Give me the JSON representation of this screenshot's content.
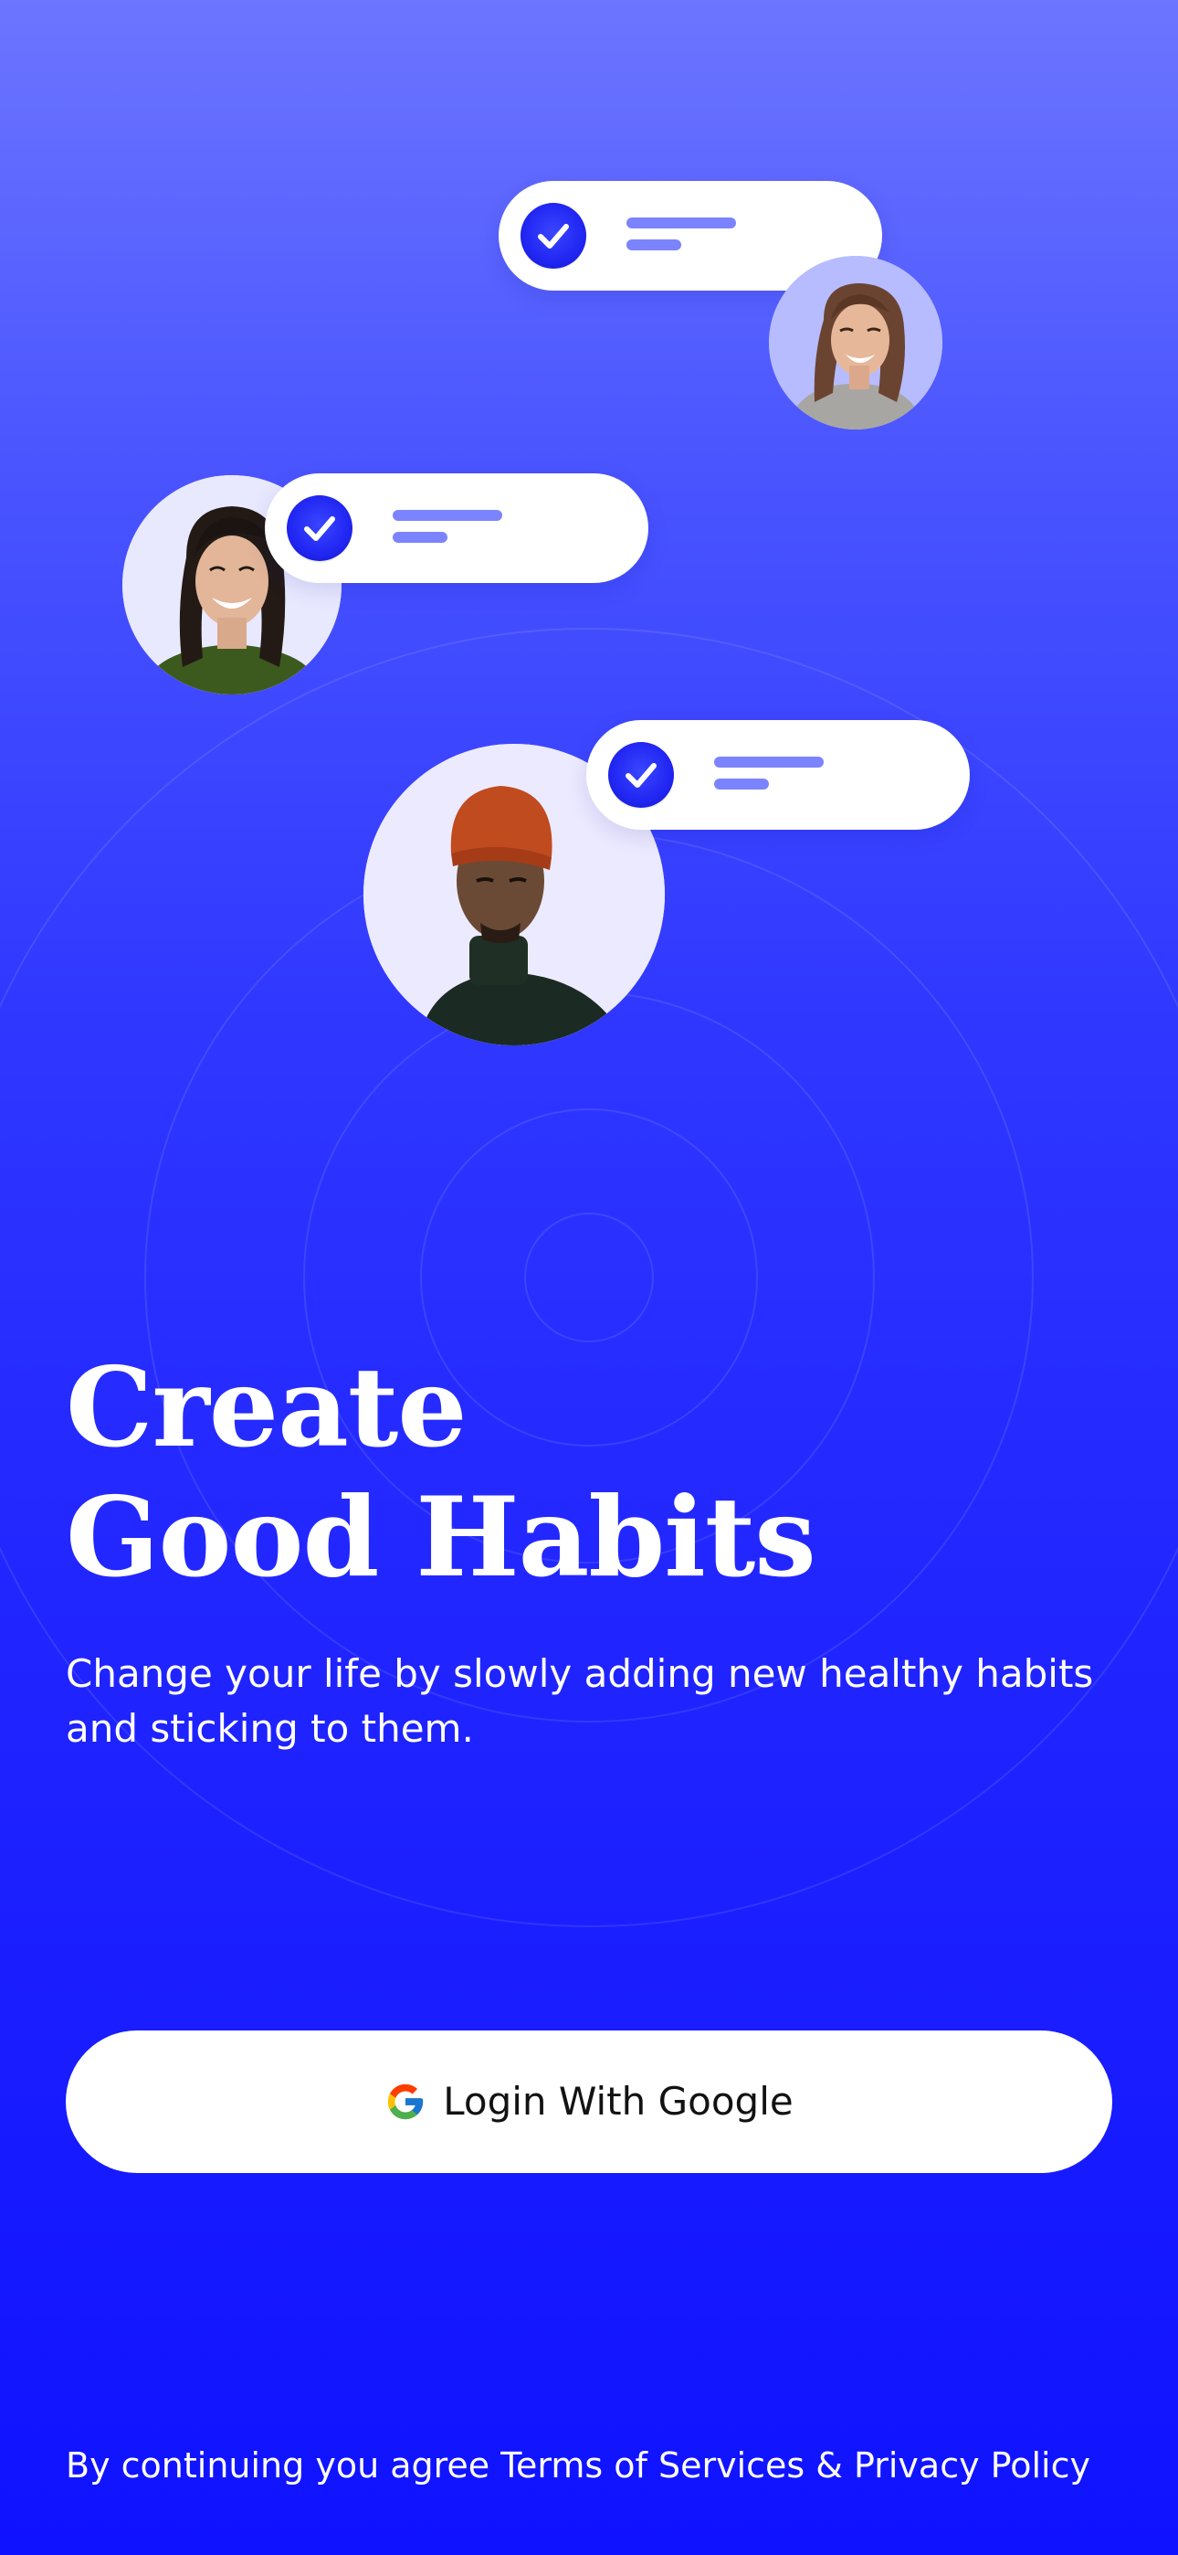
{
  "colors": {
    "background_top": "#6c75ff",
    "background_bottom": "#0f12ff",
    "accent": "#2126f2",
    "pill_line": "#7b83ff",
    "button_bg": "#ffffff",
    "text_light": "#ffffff",
    "text_dark": "#121212"
  },
  "illustration": {
    "items": [
      {
        "avatar": "woman-laughing-gray-sweater",
        "icon": "check-icon"
      },
      {
        "avatar": "woman-smiling-green-shirt",
        "icon": "check-icon"
      },
      {
        "avatar": "man-orange-beanie-black-turtleneck",
        "icon": "check-icon"
      }
    ]
  },
  "hero": {
    "title_line1": "Create",
    "title_line2": "Good Habits",
    "subtitle": "Change your life by slowly adding new healthy habits and sticking to them."
  },
  "login": {
    "icon": "google-icon",
    "label": "Login With Google"
  },
  "legal": {
    "prefix": "By continuing you agree ",
    "terms_link": "Terms of Services",
    "separator": " & ",
    "privacy_link": "Privacy Policy"
  }
}
